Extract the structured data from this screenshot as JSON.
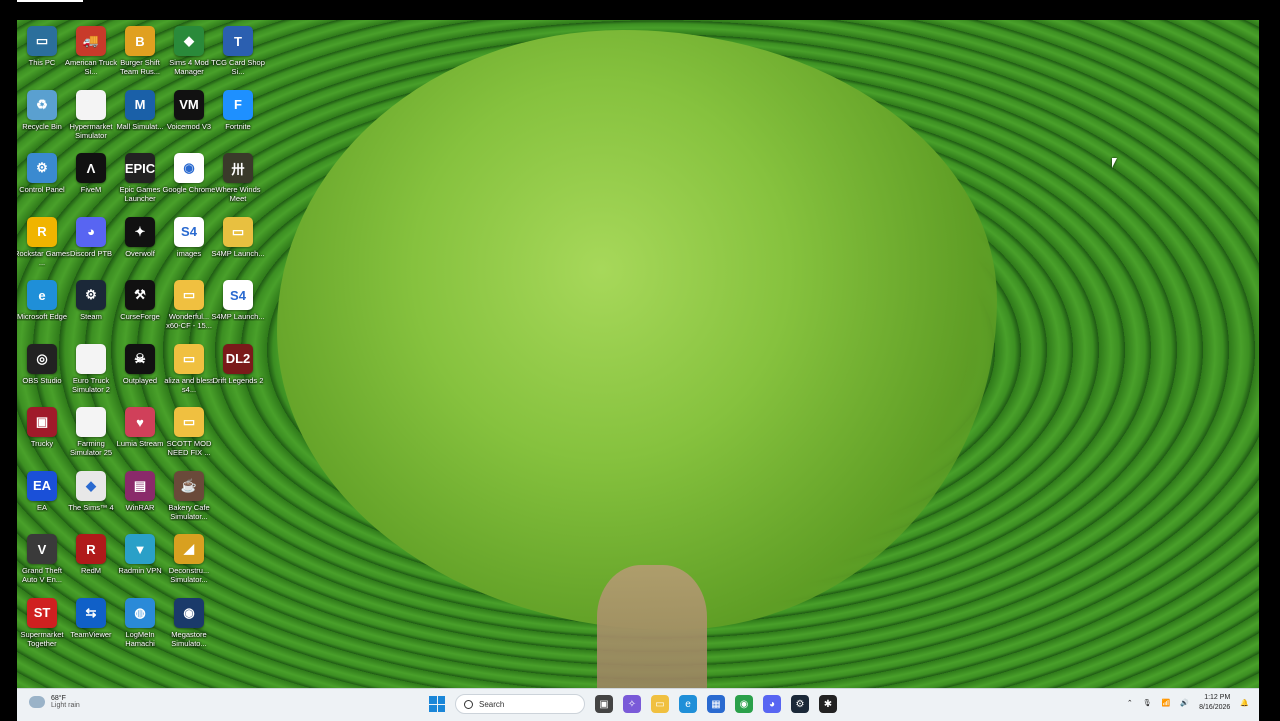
{
  "desktop": {
    "icons": [
      {
        "label": "This PC",
        "color": "#2b6f9c",
        "glyph": "▭"
      },
      {
        "label": "American Truck Si...",
        "color": "#c83a2a",
        "glyph": "🚚"
      },
      {
        "label": "Burger Shift Team Rus...",
        "color": "#e0a020",
        "glyph": "B"
      },
      {
        "label": "Sims 4 Mod Manager",
        "color": "#2a8a3a",
        "glyph": "◆"
      },
      {
        "label": "TCG Card Shop Si...",
        "color": "#2b5fb0",
        "glyph": "T"
      },
      {
        "label": "Recycle Bin",
        "color": "#5aa0d0",
        "glyph": "♻"
      },
      {
        "label": "Hypermarket Simulator",
        "color": "#f4f4f4",
        "glyph": ""
      },
      {
        "label": "Mall Simulat...",
        "color": "#1a60a8",
        "glyph": "M"
      },
      {
        "label": "Voicemod V3",
        "color": "#111111",
        "glyph": "VM"
      },
      {
        "label": "Fortnite",
        "color": "#1e90ff",
        "glyph": "F"
      },
      {
        "label": "Control Panel",
        "color": "#3a8ad0",
        "glyph": "⚙"
      },
      {
        "label": "FiveM",
        "color": "#111111",
        "glyph": "Λ"
      },
      {
        "label": "Epic Games Launcher",
        "color": "#222222",
        "glyph": "EPIC"
      },
      {
        "label": "Google Chrome",
        "color": "#ffffff",
        "glyph": "◉"
      },
      {
        "label": "Where Winds Meet",
        "color": "#3a3a2a",
        "glyph": "卅"
      },
      {
        "label": "Rockstar Games ...",
        "color": "#f0b400",
        "glyph": "R"
      },
      {
        "label": "Discord PTB",
        "color": "#5865f2",
        "glyph": "◕"
      },
      {
        "label": "Overwolf",
        "color": "#111111",
        "glyph": "✦"
      },
      {
        "label": "images",
        "color": "#ffffff",
        "glyph": "S4"
      },
      {
        "label": "S4MP Launch...",
        "color": "#e8c040",
        "glyph": "▭"
      },
      {
        "label": "Microsoft Edge",
        "color": "#1f8fd8",
        "glyph": "e"
      },
      {
        "label": "Steam",
        "color": "#1b2838",
        "glyph": "⚙"
      },
      {
        "label": "CurseForge",
        "color": "#111111",
        "glyph": "⚒"
      },
      {
        "label": "Wonderful... x60-CF - 15...",
        "color": "#f0c040",
        "glyph": "▭"
      },
      {
        "label": "S4MP Launch...",
        "color": "#ffffff",
        "glyph": "S4"
      },
      {
        "label": "OBS Studio",
        "color": "#222222",
        "glyph": "◎"
      },
      {
        "label": "Euro Truck Simulator 2",
        "color": "#f4f4f4",
        "glyph": ""
      },
      {
        "label": "Outplayed",
        "color": "#111111",
        "glyph": "☠"
      },
      {
        "label": "aliza and bless s4...",
        "color": "#f0c040",
        "glyph": "▭"
      },
      {
        "label": "Drift Legends 2",
        "color": "#7a1a1a",
        "glyph": "DL2"
      },
      {
        "label": "Trucky",
        "color": "#a01a2a",
        "glyph": "▣"
      },
      {
        "label": "Farming Simulator 25",
        "color": "#f4f4f4",
        "glyph": ""
      },
      {
        "label": "Lumia Stream",
        "color": "#d0405a",
        "glyph": "♥"
      },
      {
        "label": "SCOTT MOD NEED FIX ...",
        "color": "#f0c040",
        "glyph": "▭"
      },
      {
        "label": "",
        "color": "",
        "glyph": ""
      },
      {
        "label": "EA",
        "color": "#1a50d8",
        "glyph": "EA"
      },
      {
        "label": "The Sims™ 4",
        "color": "#e8e8e8",
        "glyph": "◆"
      },
      {
        "label": "WinRAR",
        "color": "#8a2a6a",
        "glyph": "▤"
      },
      {
        "label": "Bakery Cafe Simulator...",
        "color": "#6a4a3a",
        "glyph": "☕"
      },
      {
        "label": "",
        "color": "",
        "glyph": ""
      },
      {
        "label": "Grand Theft Auto V En...",
        "color": "#3a3a3a",
        "glyph": "V"
      },
      {
        "label": "RedM",
        "color": "#b01a1a",
        "glyph": "R"
      },
      {
        "label": "Radmin VPN",
        "color": "#2aa0c8",
        "glyph": "▼"
      },
      {
        "label": "Deconstru... Simulator...",
        "color": "#d8a020",
        "glyph": "◢"
      },
      {
        "label": "",
        "color": "",
        "glyph": ""
      },
      {
        "label": "Supermarket Together",
        "color": "#d02020",
        "glyph": "ST"
      },
      {
        "label": "TeamViewer",
        "color": "#1060c8",
        "glyph": "⇆"
      },
      {
        "label": "LogMeIn Hamachi",
        "color": "#2a8ad8",
        "glyph": "◍"
      },
      {
        "label": "Megastore Simulato...",
        "color": "#1a3a6a",
        "glyph": "◉"
      }
    ]
  },
  "taskbar": {
    "weather_temp": "68°F",
    "weather_desc": "Light rain",
    "search_placeholder": "Search",
    "apps": [
      {
        "name": "task-view",
        "color": "#444",
        "glyph": "▣"
      },
      {
        "name": "copilot",
        "color": "#7a5ad8",
        "glyph": "✧"
      },
      {
        "name": "file-explorer",
        "color": "#f0c040",
        "glyph": "▭"
      },
      {
        "name": "edge",
        "color": "#1f8fd8",
        "glyph": "e"
      },
      {
        "name": "store",
        "color": "#2a6ad0",
        "glyph": "▦"
      },
      {
        "name": "chrome",
        "color": "#2aa04a",
        "glyph": "◉"
      },
      {
        "name": "discord",
        "color": "#5865f2",
        "glyph": "◕"
      },
      {
        "name": "steam",
        "color": "#1b2838",
        "glyph": "⚙"
      },
      {
        "name": "app",
        "color": "#222",
        "glyph": "✱"
      }
    ],
    "time": "1:12 PM",
    "date": "8/16/2026"
  }
}
